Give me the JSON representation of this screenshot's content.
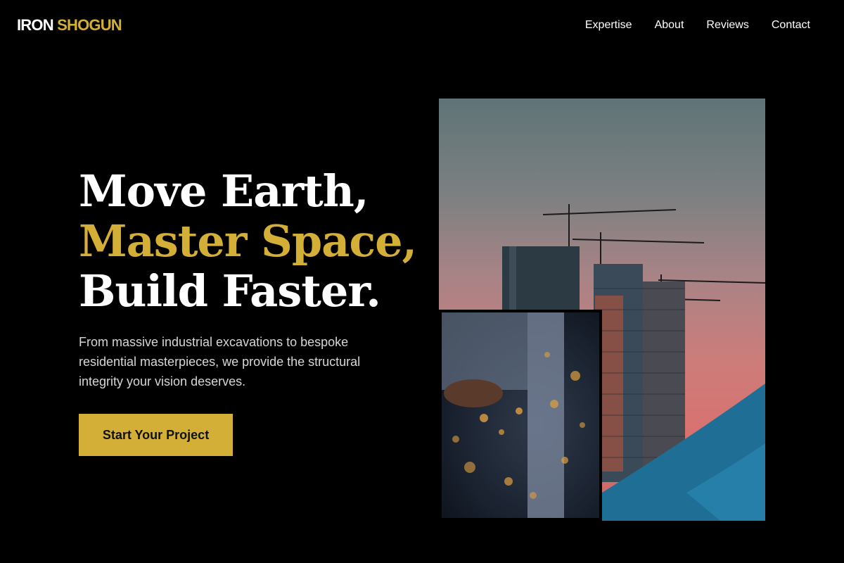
{
  "brand": {
    "word1": "IRON",
    "word2": "SHOGUN"
  },
  "nav": {
    "expertise": "Expertise",
    "about": "About",
    "reviews": "Reviews",
    "contact": "Contact"
  },
  "hero": {
    "line1": "Move Earth,",
    "line2": "Master Space,",
    "line3": "Build Faster.",
    "subtitle": "From massive industrial excavations to bespoke residential masterpieces, we provide the structural integrity your vision deserves.",
    "cta_label": "Start Your Project"
  },
  "colors": {
    "accent": "#d4af37",
    "background": "#000000",
    "text": "#ffffff"
  }
}
